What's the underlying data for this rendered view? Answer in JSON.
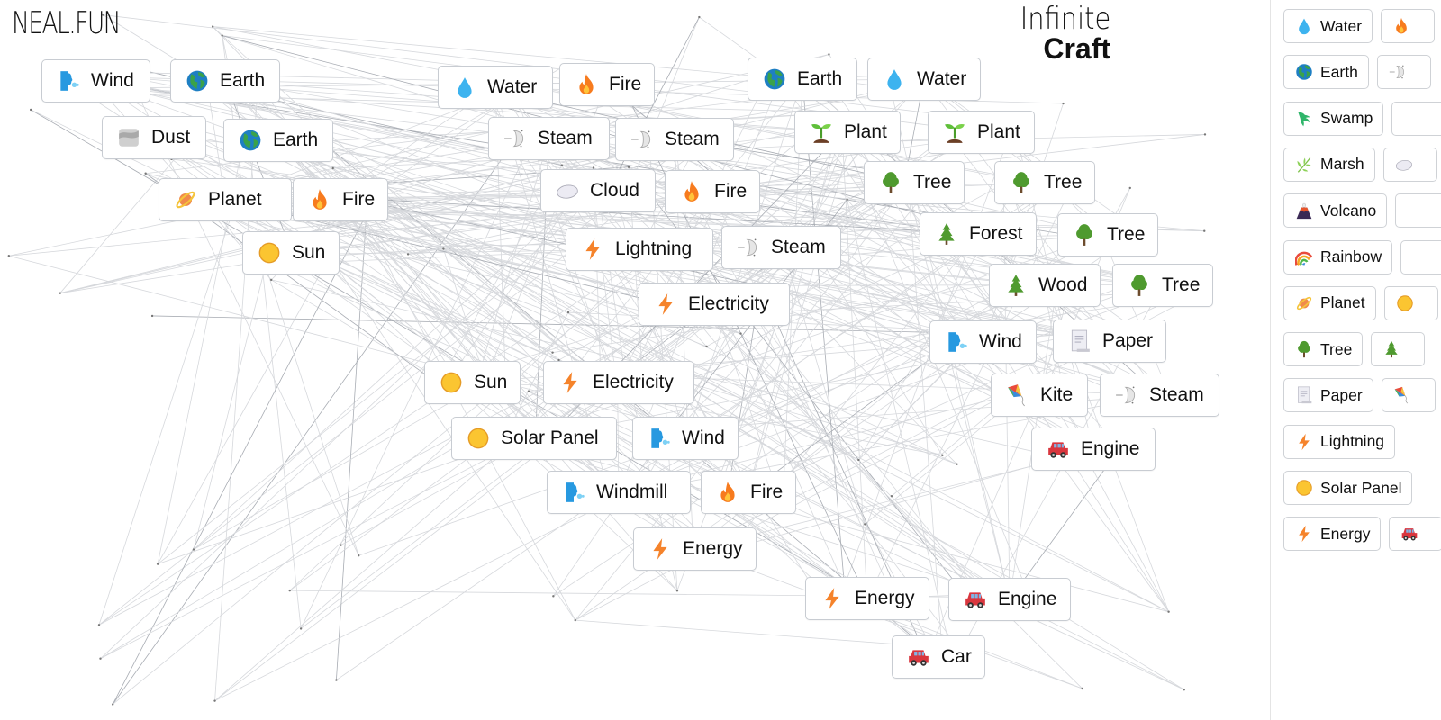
{
  "header": {
    "logo": "NEAL.FUN",
    "title_line1": "Infinite",
    "title_line2": "Craft"
  },
  "colors": {
    "card_border": "#c8ccd2",
    "line": "#d6d8dc",
    "background": "#ffffff"
  },
  "canvas": {
    "items": [
      {
        "label": "Wind",
        "icon": "wind-face-icon"
      },
      {
        "label": "Earth",
        "icon": "earth-globe-icon"
      },
      {
        "label": "Dust",
        "icon": "dust-icon"
      },
      {
        "label": "Earth",
        "icon": "earth-globe-icon"
      },
      {
        "label": "Planet",
        "icon": "planet-icon"
      },
      {
        "label": "Fire",
        "icon": "fire-icon"
      },
      {
        "label": "Sun",
        "icon": "sun-icon"
      },
      {
        "label": "Water",
        "icon": "water-drop-icon"
      },
      {
        "label": "Fire",
        "icon": "fire-icon"
      },
      {
        "label": "Steam",
        "icon": "steam-icon"
      },
      {
        "label": "Steam",
        "icon": "steam-icon"
      },
      {
        "label": "Cloud",
        "icon": "cloud-icon"
      },
      {
        "label": "Fire",
        "icon": "fire-icon"
      },
      {
        "label": "Lightning",
        "icon": "lightning-icon"
      },
      {
        "label": "Steam",
        "icon": "steam-icon"
      },
      {
        "label": "Electricity",
        "icon": "lightning-icon"
      },
      {
        "label": "Earth",
        "icon": "earth-globe-icon"
      },
      {
        "label": "Water",
        "icon": "water-drop-icon"
      },
      {
        "label": "Plant",
        "icon": "seedling-icon"
      },
      {
        "label": "Plant",
        "icon": "seedling-icon"
      },
      {
        "label": "Tree",
        "icon": "tree-icon"
      },
      {
        "label": "Tree",
        "icon": "tree-icon"
      },
      {
        "label": "Forest",
        "icon": "evergreen-tree-icon"
      },
      {
        "label": "Tree",
        "icon": "tree-icon"
      },
      {
        "label": "Wood",
        "icon": "evergreen-tree-icon"
      },
      {
        "label": "Tree",
        "icon": "tree-icon"
      },
      {
        "label": "Wind",
        "icon": "wind-face-icon"
      },
      {
        "label": "Paper",
        "icon": "paper-icon"
      },
      {
        "label": "Kite",
        "icon": "kite-icon"
      },
      {
        "label": "Steam",
        "icon": "steam-icon"
      },
      {
        "label": "Engine",
        "icon": "car-icon"
      },
      {
        "label": "Sun",
        "icon": "sun-icon"
      },
      {
        "label": "Electricity",
        "icon": "lightning-icon"
      },
      {
        "label": "Solar Panel",
        "icon": "sun-icon"
      },
      {
        "label": "Wind",
        "icon": "wind-face-icon"
      },
      {
        "label": "Windmill",
        "icon": "wind-face-icon"
      },
      {
        "label": "Fire",
        "icon": "fire-icon"
      },
      {
        "label": "Energy",
        "icon": "lightning-icon"
      },
      {
        "label": "Energy",
        "icon": "lightning-icon"
      },
      {
        "label": "Engine",
        "icon": "car-icon"
      },
      {
        "label": "Car",
        "icon": "car-icon"
      }
    ]
  },
  "sidebar": {
    "rows": [
      [
        {
          "label": "Water",
          "icon": "water-drop-icon"
        },
        {
          "label": "",
          "icon": "fire-icon"
        }
      ],
      [
        {
          "label": "Earth",
          "icon": "earth-globe-icon"
        },
        {
          "label": "",
          "icon": "steam-icon"
        }
      ],
      [
        {
          "label": "Swamp",
          "icon": "swamp-icon"
        },
        {
          "label": "",
          "icon": ""
        }
      ],
      [
        {
          "label": "Marsh",
          "icon": "marsh-icon"
        },
        {
          "label": "",
          "icon": "cloud-icon"
        }
      ],
      [
        {
          "label": "Volcano",
          "icon": "volcano-icon"
        },
        {
          "label": "",
          "icon": ""
        }
      ],
      [
        {
          "label": "Rainbow",
          "icon": "rainbow-icon"
        },
        {
          "label": "",
          "icon": ""
        }
      ],
      [
        {
          "label": "Planet",
          "icon": "planet-icon"
        },
        {
          "label": "",
          "icon": "sun-icon"
        }
      ],
      [
        {
          "label": "Tree",
          "icon": "tree-icon"
        },
        {
          "label": "",
          "icon": "evergreen-tree-icon"
        }
      ],
      [
        {
          "label": "Paper",
          "icon": "paper-icon"
        },
        {
          "label": "",
          "icon": "kite-icon"
        }
      ],
      [
        {
          "label": "Lightning",
          "icon": "lightning-icon"
        }
      ],
      [
        {
          "label": "Solar Panel",
          "icon": "sun-icon"
        }
      ],
      [
        {
          "label": "Energy",
          "icon": "lightning-icon"
        },
        {
          "label": "",
          "icon": "car-icon"
        }
      ]
    ]
  }
}
